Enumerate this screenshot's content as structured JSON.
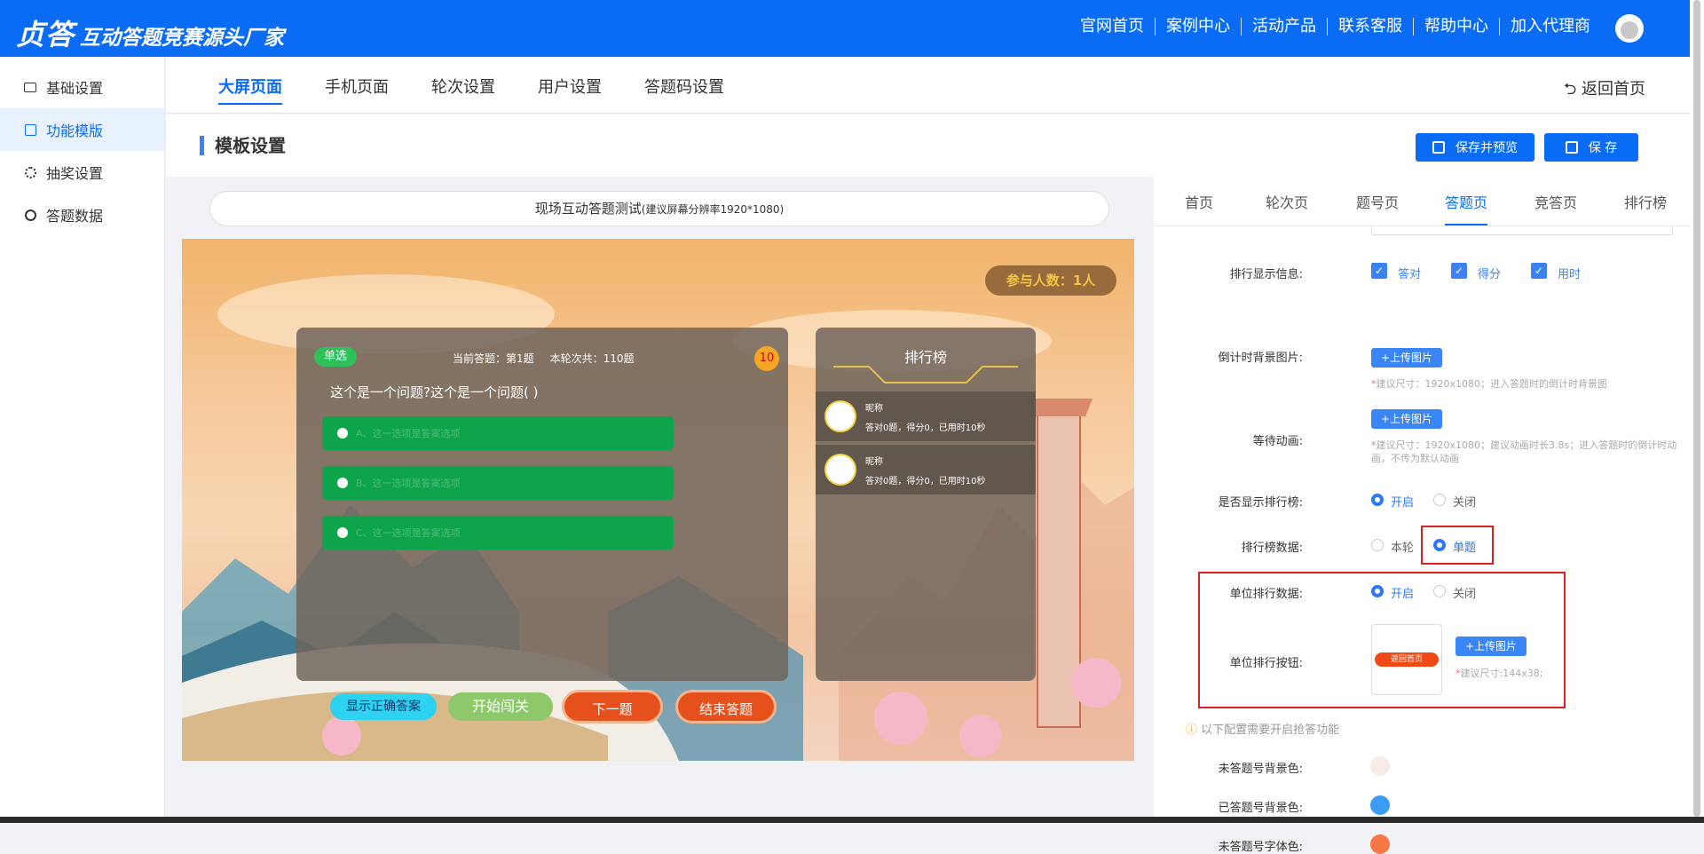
{
  "header": {
    "logo_big": "贞答",
    "logo_sub": "互动答题竞赛源头厂家",
    "nav": [
      "官网首页",
      "案例中心",
      "活动产品",
      "联系客服",
      "帮助中心",
      "加入代理商"
    ]
  },
  "sidebar": {
    "items": [
      {
        "label": "基础设置",
        "icon": "monitor-icon"
      },
      {
        "label": "功能模版",
        "icon": "calendar-icon"
      },
      {
        "label": "抽奖设置",
        "icon": "gear-icon"
      },
      {
        "label": "答题数据",
        "icon": "database-icon"
      }
    ],
    "active": "功能模版"
  },
  "tabs": [
    "大屏页面",
    "手机页面",
    "轮次设置",
    "用户设置",
    "答题码设置"
  ],
  "active_tab": "大屏页面",
  "back_home": "返回首页",
  "section_title": "模板设置",
  "actions": {
    "save_preview": "保存并预览",
    "save": "保 存"
  },
  "preview": {
    "title": "现场互动答题测试",
    "title_hint": "(建议屏幕分辨率1920*1080)",
    "participants": "参与人数：1人",
    "question_type": "单选",
    "current_q": "当前答题：第1题",
    "round_total": "本轮次共：110题",
    "countdown": "10",
    "question": "这个是一个问题?这个是一个问题( )",
    "options": [
      "A、这一选项是答案选项",
      "B、这一选项是答案选项",
      "C、这一选项是答案选项"
    ],
    "ranking_title": "排行榜",
    "ranking": [
      {
        "name": "昵称",
        "score": "答对0题，得分0，已用时10秒"
      },
      {
        "name": "昵称",
        "score": "答对0题，得分0，已用时10秒"
      }
    ],
    "buttons": [
      "显示正确答案",
      "开始闯关",
      "下一题",
      "结束答题"
    ]
  },
  "settings": {
    "tabs": [
      "首页",
      "轮次页",
      "题号页",
      "答题页",
      "竞答页",
      "排行榜"
    ],
    "active_tab": "答题页",
    "rank_info_label": "排行显示信息:",
    "rank_info_opts": [
      "答对",
      "得分",
      "用时"
    ],
    "countdown_bg_label": "倒计时背景图片:",
    "upload": "+上传图片",
    "countdown_hint_star": "*",
    "countdown_hint": "建议尺寸：1920x1080；进入答题时的倒计时背景图",
    "wait_anim_label": "等待动画:",
    "wait_hint": "建议尺寸：1920x1080；建议动画时长3.8s；进入答题时的倒计时动画，不传为默认动画",
    "show_rank_label": "是否显示排行榜:",
    "open": "开启",
    "close": "关闭",
    "rank_data_label": "排行榜数据:",
    "rank_round": "本轮",
    "rank_single": "单题",
    "unit_rank_label": "单位排行数据:",
    "unit_btn_label": "单位排行按钮:",
    "unit_btn_image_text": "返回首页",
    "unit_btn_hint": "建议尺寸:144x38;",
    "notice": "以下配置需要开启抢答功能",
    "color_rows": [
      {
        "label": "未答题号背景色:",
        "color": "#f9ece6"
      },
      {
        "label": "已答题号背景色:",
        "color": "#3b9cf5"
      },
      {
        "label": "未答题号字体色:",
        "color": "#f87845"
      }
    ]
  }
}
